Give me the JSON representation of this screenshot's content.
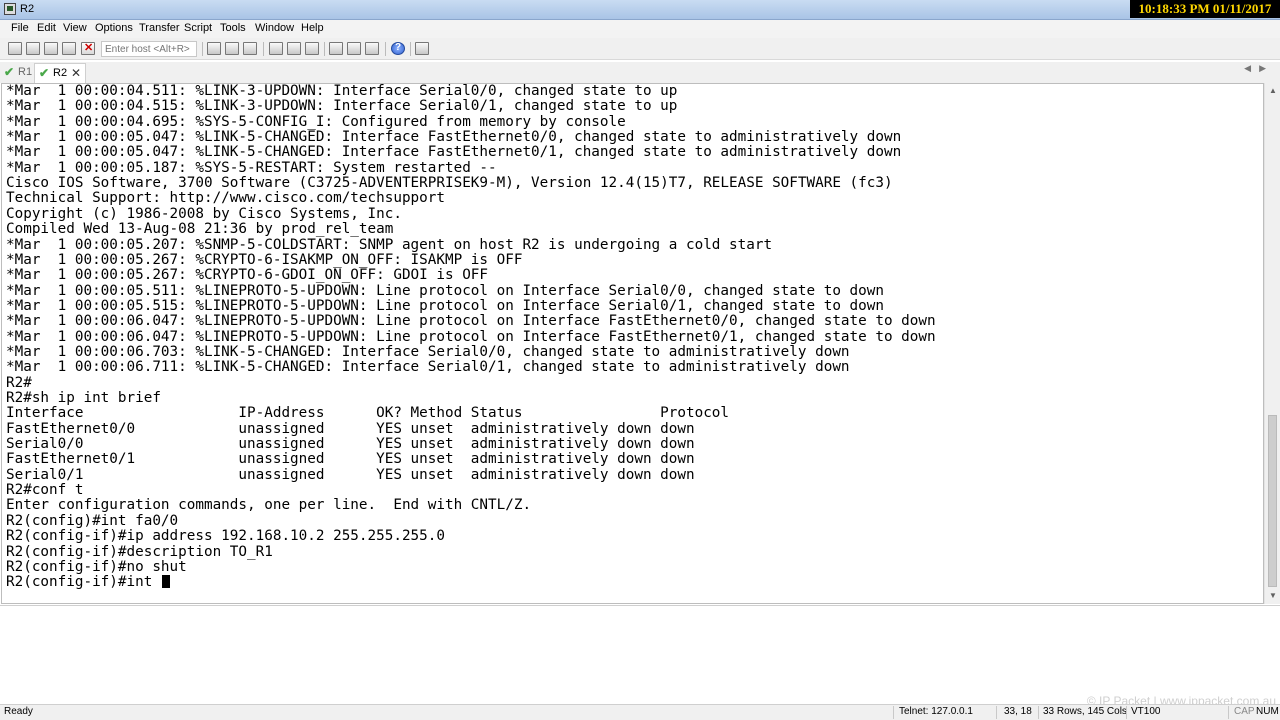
{
  "window": {
    "title": "R2",
    "clock": "10:18:33 PM 01/11/2017"
  },
  "menu": [
    "File",
    "Edit",
    "View",
    "Options",
    "Transfer",
    "Script",
    "Tools",
    "Window",
    "Help"
  ],
  "toolbar": {
    "host_placeholder": "Enter host <Alt+R>"
  },
  "tabs": [
    {
      "label": "R1",
      "active": false
    },
    {
      "label": "R2",
      "active": true
    }
  ],
  "terminal": {
    "lines": [
      "*Mar  1 00:00:04.511: %LINK-3-UPDOWN: Interface Serial0/0, changed state to up",
      "*Mar  1 00:00:04.515: %LINK-3-UPDOWN: Interface Serial0/1, changed state to up",
      "*Mar  1 00:00:04.695: %SYS-5-CONFIG_I: Configured from memory by console",
      "*Mar  1 00:00:05.047: %LINK-5-CHANGED: Interface FastEthernet0/0, changed state to administratively down",
      "*Mar  1 00:00:05.047: %LINK-5-CHANGED: Interface FastEthernet0/1, changed state to administratively down",
      "*Mar  1 00:00:05.187: %SYS-5-RESTART: System restarted --",
      "Cisco IOS Software, 3700 Software (C3725-ADVENTERPRISEK9-M), Version 12.4(15)T7, RELEASE SOFTWARE (fc3)",
      "Technical Support: http://www.cisco.com/techsupport",
      "Copyright (c) 1986-2008 by Cisco Systems, Inc.",
      "Compiled Wed 13-Aug-08 21:36 by prod_rel_team",
      "*Mar  1 00:00:05.207: %SNMP-5-COLDSTART: SNMP agent on host R2 is undergoing a cold start",
      "*Mar  1 00:00:05.267: %CRYPTO-6-ISAKMP_ON_OFF: ISAKMP is OFF",
      "*Mar  1 00:00:05.267: %CRYPTO-6-GDOI_ON_OFF: GDOI is OFF",
      "*Mar  1 00:00:05.511: %LINEPROTO-5-UPDOWN: Line protocol on Interface Serial0/0, changed state to down",
      "*Mar  1 00:00:05.515: %LINEPROTO-5-UPDOWN: Line protocol on Interface Serial0/1, changed state to down",
      "*Mar  1 00:00:06.047: %LINEPROTO-5-UPDOWN: Line protocol on Interface FastEthernet0/0, changed state to down",
      "*Mar  1 00:00:06.047: %LINEPROTO-5-UPDOWN: Line protocol on Interface FastEthernet0/1, changed state to down",
      "*Mar  1 00:00:06.703: %LINK-5-CHANGED: Interface Serial0/0, changed state to administratively down",
      "*Mar  1 00:00:06.711: %LINK-5-CHANGED: Interface Serial0/1, changed state to administratively down",
      "R2#",
      "R2#sh ip int brief",
      "Interface                  IP-Address      OK? Method Status                Protocol",
      "FastEthernet0/0            unassigned      YES unset  administratively down down",
      "Serial0/0                  unassigned      YES unset  administratively down down",
      "FastEthernet0/1            unassigned      YES unset  administratively down down",
      "Serial0/1                  unassigned      YES unset  administratively down down",
      "R2#conf t",
      "Enter configuration commands, one per line.  End with CNTL/Z.",
      "R2(config)#int fa0/0",
      "R2(config-if)#ip address 192.168.10.2 255.255.255.0",
      "R2(config-if)#description TO_R1",
      "R2(config-if)#no shut",
      "R2(config-if)#int "
    ]
  },
  "watermark": "© IP Packet | www.ippacket.com.au",
  "status": {
    "ready": "Ready",
    "connection": "Telnet: 127.0.0.1",
    "cursor_pos": "33, 18",
    "size": "33 Rows, 145 Cols",
    "emulation": "VT100",
    "caps": "CAP",
    "num": "NUM"
  }
}
